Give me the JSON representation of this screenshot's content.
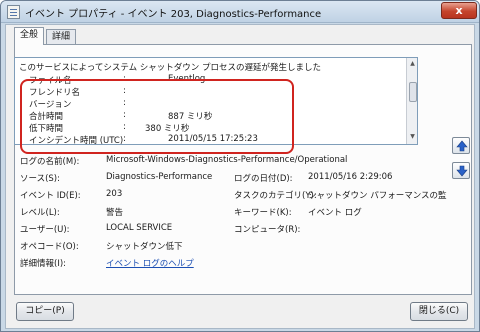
{
  "window": {
    "title": "イベント プロパティ - イベント 203, Diagnostics-Performance",
    "close_symbol": "x"
  },
  "tabs": [
    {
      "label": "全般"
    },
    {
      "label": "詳細"
    }
  ],
  "detail": {
    "message": "このサービスによってシステム シャットダウン プロセスの遅延が発生しました",
    "fields": [
      {
        "label": "ファイル名",
        "sep": ":",
        "value": "Eventlog"
      },
      {
        "label": "フレンドリ名",
        "sep": ":",
        "value": ""
      },
      {
        "label": "バージョン",
        "sep": ":",
        "value": ""
      },
      {
        "label": "合計時間",
        "sep": ":",
        "value": "887 ミリ秒"
      },
      {
        "label": "低下時間",
        "sep": ":",
        "value": "380 ミリ秒"
      },
      {
        "label": "インシデント時間 (UTC)",
        "sep": ":",
        "value": "2011/05/15 17:25:23"
      }
    ]
  },
  "properties": {
    "log_name_label": "ログの名前(M):",
    "log_name_value": "Microsoft-Windows-Diagnostics-Performance/Operational",
    "source_label": "ソース(S):",
    "source_value": "Diagnostics-Performance",
    "logged_label": "ログの日付(D):",
    "logged_value": "2011/05/16 2:29:06",
    "event_id_label": "イベント ID(E):",
    "event_id_value": "203",
    "task_label": "タスクのカテゴリ(Y):",
    "task_value": "シャットダウン パフォーマンスの監",
    "level_label": "レベル(L):",
    "level_value": "警告",
    "keywords_label": "キーワード(K):",
    "keywords_value": "イベント ログ",
    "user_label": "ユーザー(U):",
    "user_value": "LOCAL SERVICE",
    "computer_label": "コンピュータ(R):",
    "computer_value": "",
    "opcode_label": "オペコード(O):",
    "opcode_value": "シャットダウン低下",
    "more_info_label": "詳細情報(I):",
    "more_info_link": "イベント ログのヘルプ"
  },
  "buttons": {
    "copy": "コピー(P)",
    "close": "閉じる(C)"
  },
  "colors": {
    "highlight": "#d0241f",
    "link": "#1c4fb3",
    "arrow_blue": "#2b62c8"
  },
  "icons": {
    "up": "arrow-up-icon",
    "down": "arrow-down-icon"
  }
}
